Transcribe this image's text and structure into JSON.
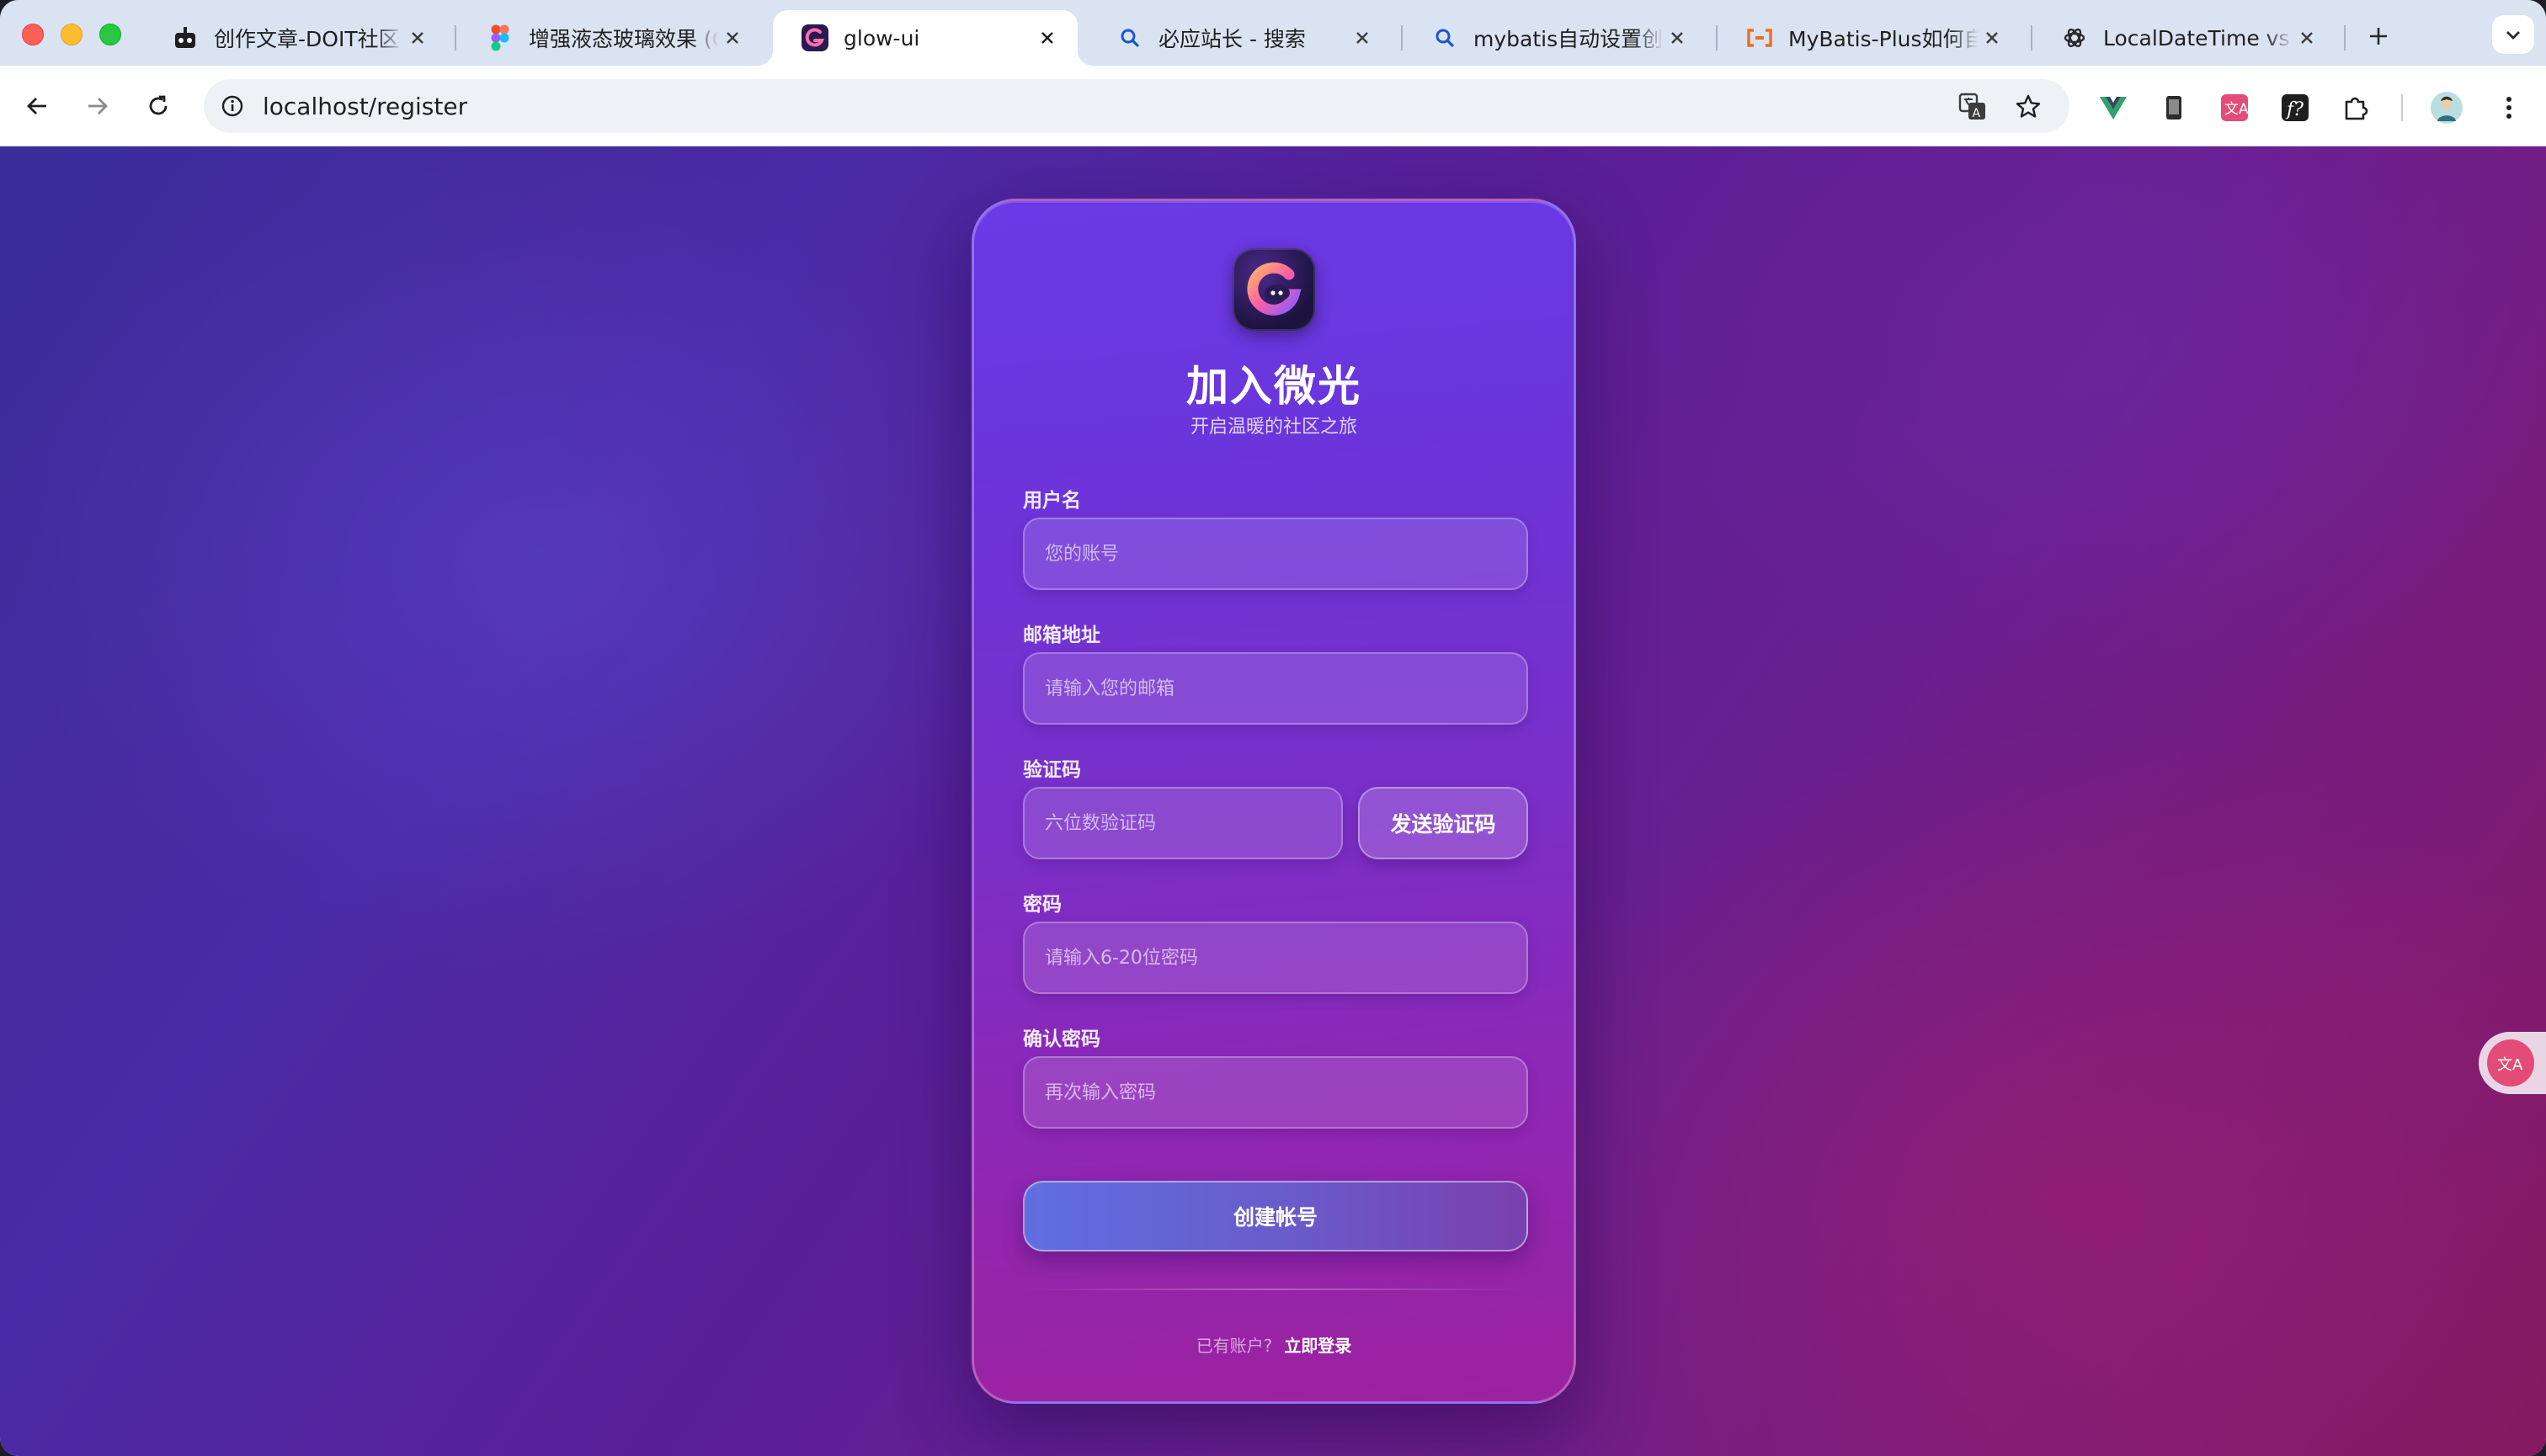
{
  "browser": {
    "tabs": [
      {
        "title": "创作文章-DOIT社区",
        "icon": "robot-icon"
      },
      {
        "title": "增强液态玻璃效果 (Cc",
        "icon": "figma-icon"
      },
      {
        "title": "glow-ui",
        "icon": "glow-logo-icon",
        "active": true
      },
      {
        "title": "必应站长 - 搜索",
        "icon": "search-icon"
      },
      {
        "title": "mybatis自动设置创建",
        "icon": "search-icon"
      },
      {
        "title": "MyBatis-Plus如何自动",
        "icon": "bracket-logo-icon"
      },
      {
        "title": "LocalDateTime vs Da",
        "icon": "openai-icon"
      }
    ],
    "url": "localhost/register",
    "colors": {
      "accent_orange": "#f26b1d",
      "ext_green": "#2ea36b",
      "ext_pink": "#e34b78"
    }
  },
  "register": {
    "title": "加入微光",
    "subtitle": "开启温暖的社区之旅",
    "fields": {
      "username": {
        "label": "用户名",
        "placeholder": "您的账号"
      },
      "email": {
        "label": "邮箱地址",
        "placeholder": "请输入您的邮箱"
      },
      "code": {
        "label": "验证码",
        "placeholder": "六位数验证码",
        "send_label": "发送验证码"
      },
      "password": {
        "label": "密码",
        "placeholder": "请输入6-20位密码"
      },
      "confirm": {
        "label": "确认密码",
        "placeholder": "再次输入密码"
      }
    },
    "submit_label": "创建帐号",
    "footer": {
      "prompt": "已有账户?",
      "login_link": "立即登录"
    }
  }
}
